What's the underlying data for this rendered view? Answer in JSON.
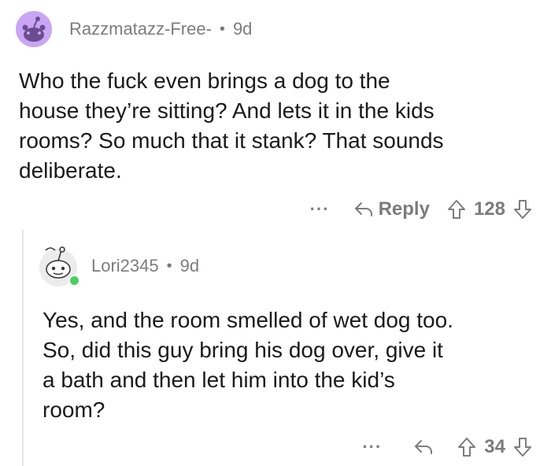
{
  "comments": [
    {
      "username": "Razzmatazz-Free-",
      "separator": "•",
      "age": "9d",
      "lines": [
        "Who the fuck even brings a dog to the",
        "house they’re sitting? And lets it in the kids",
        "rooms? So much that it stank? That sounds",
        "deliberate."
      ],
      "more_label": "···",
      "reply_label": "Reply",
      "score": "128",
      "avatar_icon": "snoo-avatar-icon"
    },
    {
      "username": "Lori2345",
      "separator": "•",
      "age": "9d",
      "lines": [
        "Yes, and the room smelled of wet dog too.",
        "So, did this guy bring his dog over, give it",
        "a bath and then let him into the kid’s",
        "room?"
      ],
      "more_label": "···",
      "score": "34",
      "online": true,
      "avatar_icon": "snoo-avatar-icon"
    }
  ],
  "colors": {
    "meta_gray": "#7c7c7c",
    "avatar_purple": "#c8a6f5",
    "online_green": "#46d160",
    "thread_line": "#e6e6e6"
  }
}
